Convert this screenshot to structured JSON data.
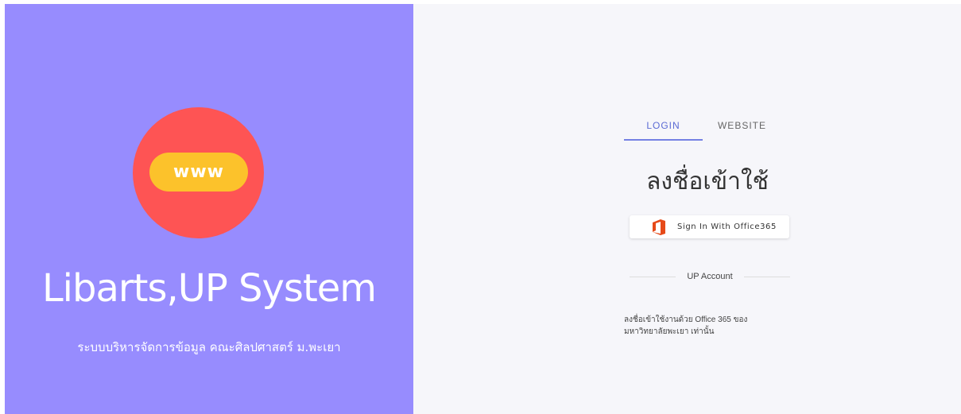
{
  "colors": {
    "left_bg": "#978cfe",
    "logo_circle": "#fe5454",
    "logo_pill": "#fcc22b",
    "right_bg": "#f6f6fa",
    "tab_active": "#5b6bd4"
  },
  "brand": {
    "logo_text": "www",
    "title": "Libarts,UP System",
    "subtitle": "ระบบบริหารจัดการข้อมูล คณะศิลปศาสตร์ ม.พะเยา"
  },
  "tabs": [
    {
      "label": "LOGIN",
      "active": true
    },
    {
      "label": "WEBSITE",
      "active": false
    }
  ],
  "login": {
    "heading": "ลงชื่อเข้าใช้",
    "office_button_label": "Sign In With Office365",
    "office_icon": "office365-icon",
    "divider_label": "UP Account",
    "note_line1": "ลงชื่อเข้าใช้งานด้วย Office 365 ของ",
    "note_line2": "มหาวิทยาลัยพะเยา เท่านั้น"
  }
}
